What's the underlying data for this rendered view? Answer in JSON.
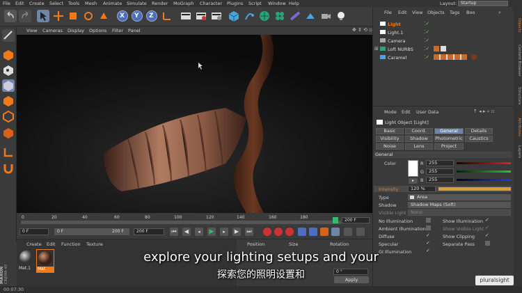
{
  "menubar": {
    "items": [
      "File",
      "Edit",
      "Create",
      "Select",
      "Tools",
      "Mesh",
      "Animate",
      "Simulate",
      "Render",
      "MoGraph",
      "Character",
      "Plugins",
      "Script",
      "Window",
      "Help"
    ],
    "layout_label": "Layout:",
    "layout_value": "Startup"
  },
  "toolbar": {
    "icons": [
      "undo-icon",
      "redo-icon",
      "select-icon",
      "move-icon",
      "scale-icon",
      "rotate-icon",
      "model-icon",
      "x-axis-icon",
      "y-axis-icon",
      "z-axis-icon",
      "coord-icon",
      "render-view-icon",
      "render-pv-icon",
      "render-settings-icon",
      "cube-icon",
      "pen-icon",
      "subdiv-icon",
      "cloner-icon",
      "deformer-icon",
      "scene-icon",
      "camera-icon",
      "light-icon"
    ],
    "axis_x": "X",
    "axis_y": "Y",
    "axis_z": "Z"
  },
  "viewport": {
    "menu": [
      "View",
      "Cameras",
      "Display",
      "Options",
      "Filter",
      "Panel"
    ]
  },
  "timeline": {
    "ticks": [
      "0",
      "20",
      "40",
      "60",
      "80",
      "100",
      "120",
      "140",
      "160",
      "180"
    ],
    "end_frame": "200 F",
    "current_frame": "0 F"
  },
  "transport": {
    "start_field": "0 F",
    "min_field": "0 F",
    "max_field": "200 F",
    "end_field": "200 F"
  },
  "material_manager": {
    "menu": [
      "Create",
      "Edit",
      "Function",
      "Texture"
    ],
    "materials": [
      "Mat.1",
      "Mat"
    ]
  },
  "coordinates": {
    "headers": [
      "Position",
      "Size",
      "Rotation"
    ],
    "rot_value": "0 °",
    "apply": "Apply"
  },
  "status": {
    "time": "00:07:30"
  },
  "object_manager": {
    "menu": [
      "File",
      "Edit",
      "View",
      "Objects",
      "Tags",
      "Boo"
    ],
    "objects": [
      "Light",
      "Light.1",
      "Camera",
      "Loft NURBS",
      "Caramel"
    ]
  },
  "side_tabs": [
    "Objects",
    "Content Browser",
    "Structure",
    "Attributes",
    "Layers"
  ],
  "attributes": {
    "menu": [
      "Mode",
      "Edit",
      "User Data"
    ],
    "title": "Light Object [Light]",
    "tabs_row1": [
      "Basic",
      "Coord.",
      "General",
      "Details"
    ],
    "tabs_row2": [
      "Visibility",
      "Shadow",
      "Photometric",
      "Caustics"
    ],
    "tabs_row3": [
      "Noise",
      "Lens",
      "Project"
    ],
    "active_tab": "General",
    "section": "General",
    "color_label": "Color",
    "r_label": "R",
    "g_label": "G",
    "b_label": "B",
    "r_value": "255",
    "g_value": "255",
    "b_value": "255",
    "intensity_label": "Intensity",
    "intensity_value": "120 %",
    "type_label": "Type",
    "type_value": "Area",
    "shadow_label": "Shadow",
    "shadow_value": "Shadow Maps (Soft)",
    "visible_light_label": "Visible Light",
    "visible_light_value": "None",
    "options_left": [
      "No Illumination",
      "Ambient Illumination",
      "Diffuse",
      "Specular",
      "GI Illumination"
    ],
    "options_right": [
      "Show Illumination",
      "Show Visible Light",
      "Show Clipping",
      "Separate Pass"
    ]
  },
  "subtitles": {
    "english": "explore your lighting setups and your",
    "chinese": "探索您的照明设置和"
  },
  "watermark": "pluralsight",
  "colors": {
    "accent": "#6d86a8",
    "timeline_marker": "#2fbf6a",
    "intensity_bar": "#e09a3a"
  }
}
